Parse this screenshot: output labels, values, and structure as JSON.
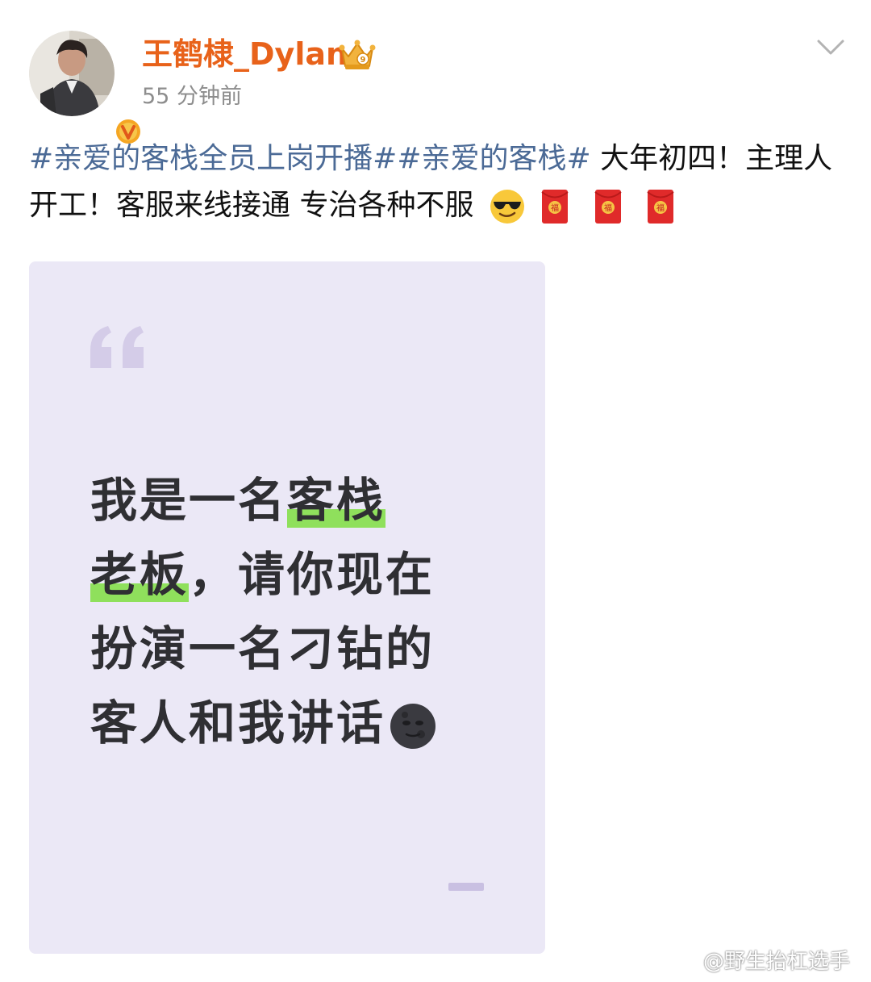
{
  "header": {
    "username": "王鹤棣_Dylan",
    "timestamp": "55 分钟前",
    "menu_icon": "chevron-down-icon",
    "crown_icon": "crown-icon",
    "verified_icon": "verified-v-icon"
  },
  "post": {
    "hashtag_1": "#亲爱的客栈全员上岗开播#",
    "hashtag_2": "#亲爱的客栈#",
    "body": " 大年初四！主理人开工！客服来线接通 专治各种不服",
    "emojis": [
      "sunglasses-emoji",
      "red-envelope-emoji",
      "red-envelope-emoji",
      "red-envelope-emoji"
    ]
  },
  "card": {
    "line1_a": "我是一名",
    "line1_b": "客栈",
    "line2_a": "老板",
    "line2_b": "，请你现在",
    "line3": "扮演一名刁钻的",
    "line4": "客人和我讲话",
    "emoji": "new-moon-face-emoji"
  },
  "watermark": {
    "text": "@野生抬杠选手",
    "icon": "weibo-logo-icon"
  },
  "colors": {
    "username": "#e8621a",
    "hashtag": "#4b6a96",
    "card_bg": "#ebe8f6",
    "highlight": "#8fe05c"
  }
}
